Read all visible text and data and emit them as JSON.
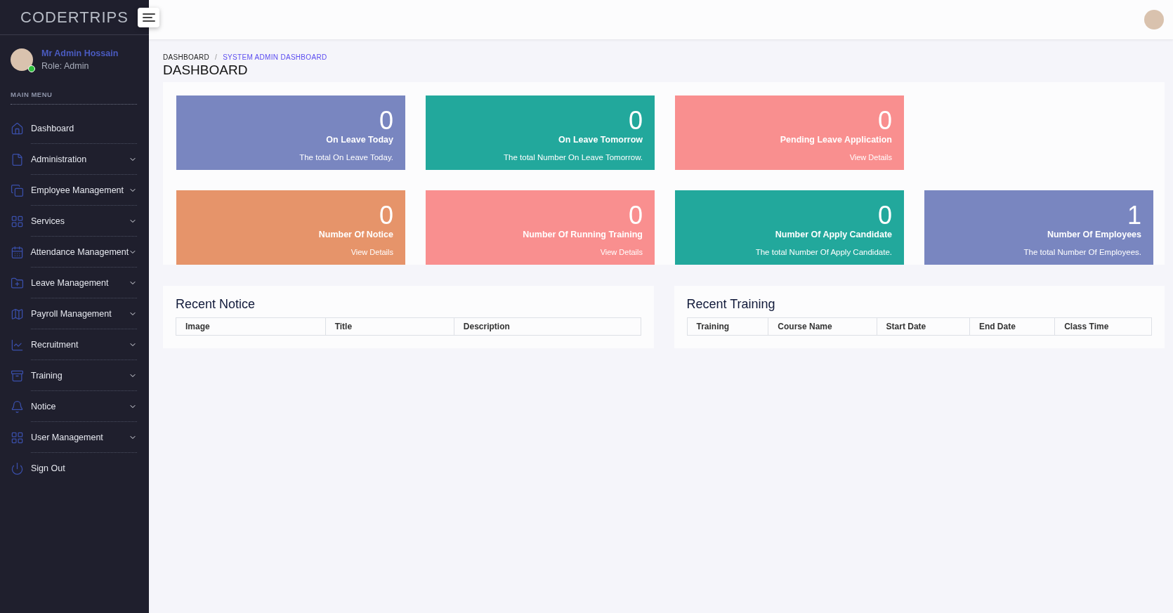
{
  "sidebar": {
    "logo": "CODERTRIPS",
    "user": {
      "name": "Mr Admin Hossain",
      "role": "Role: Admin",
      "online": true
    },
    "menu_heading": "MAIN MENU",
    "items": [
      {
        "label": "Dashboard",
        "expandable": false
      },
      {
        "label": "Administration",
        "expandable": true
      },
      {
        "label": "Employee Management",
        "expandable": true
      },
      {
        "label": "Services",
        "expandable": true
      },
      {
        "label": "Attendance Management",
        "expandable": true
      },
      {
        "label": "Leave Management",
        "expandable": true
      },
      {
        "label": "Payroll Management",
        "expandable": true
      },
      {
        "label": "Recruitment",
        "expandable": true
      },
      {
        "label": "Training",
        "expandable": true
      },
      {
        "label": "Notice",
        "expandable": true
      },
      {
        "label": "User Management",
        "expandable": true
      },
      {
        "label": "Sign Out",
        "expandable": false
      }
    ]
  },
  "breadcrumb": [
    "DASHBOARD",
    "SYSTEM ADMIN DASHBOARD"
  ],
  "breadcrumb_separator": "/",
  "page_title": "DASHBOARD",
  "card_rows": [
    [
      {
        "value": "0",
        "title": "On Leave Today",
        "footer": "The total On Leave Today.",
        "kind": "text",
        "color": "#7986c0"
      },
      {
        "value": "0",
        "title": "On Leave Tomorrow",
        "footer": "The total Number On Leave Tomorrow.",
        "kind": "text",
        "color": "#22a89c"
      },
      {
        "value": "0",
        "title": "Pending Leave Application",
        "footer": "View Details",
        "kind": "link",
        "color": "#f98f8f"
      }
    ],
    [
      {
        "value": "0",
        "title": "Number Of Notice",
        "footer": "View Details",
        "kind": "link",
        "color": "#e6946a"
      },
      {
        "value": "0",
        "title": "Number Of Running Training",
        "footer": "View Details",
        "kind": "link",
        "color": "#f98f8f"
      },
      {
        "value": "0",
        "title": "Number Of Apply Candidate",
        "footer": "The total Number Of Apply Candidate.",
        "kind": "text",
        "color": "#22a89c"
      },
      {
        "value": "1",
        "title": "Number Of Employees",
        "footer": "The total Number Of Employees.",
        "kind": "text",
        "color": "#7986c0"
      }
    ]
  ],
  "tables": [
    {
      "title": "Recent Notice",
      "columns": [
        "Image",
        "Title",
        "Description"
      ]
    },
    {
      "title": "Recent Training",
      "columns": [
        "Training",
        "Course Name",
        "Start Date",
        "End Date",
        "Class Time"
      ]
    }
  ]
}
